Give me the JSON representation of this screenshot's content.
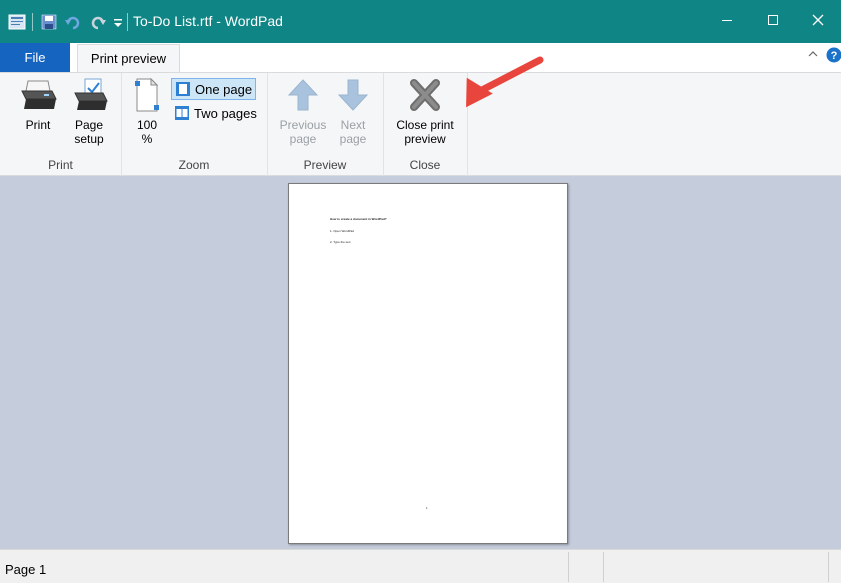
{
  "window": {
    "title": "To-Do List.rtf - WordPad",
    "minimize_icon": "minimize-icon",
    "maximize_icon": "maximize-icon",
    "close_icon": "close-icon",
    "accent_color": "#0f8585"
  },
  "quick_access": {
    "app_icon": "wordpad-icon",
    "save_icon": "save-icon",
    "undo_icon": "undo-icon",
    "redo_icon": "redo-icon",
    "customize_icon": "customize-dropdown-icon"
  },
  "tabs": {
    "file_label": "File",
    "print_preview_label": "Print preview",
    "file_color": "#1564c0"
  },
  "ribbon": {
    "print_group": {
      "label": "Print",
      "print_button": "Print",
      "page_setup_line1": "Page",
      "page_setup_line2": "setup"
    },
    "zoom_group": {
      "label": "Zoom",
      "zoom_line1": "100",
      "zoom_line2": "%",
      "one_page": "One page",
      "two_pages": "Two pages",
      "selected": "One page"
    },
    "preview_group": {
      "label": "Preview",
      "previous_line1": "Previous",
      "previous_line2": "page",
      "next_line1": "Next",
      "next_line2": "page"
    },
    "close_group": {
      "label": "Close",
      "close_line1": "Close print",
      "close_line2": "preview"
    }
  },
  "annotation": {
    "arrow_color": "#e8453c"
  },
  "document": {
    "heading": "How to create a document in WordPad?",
    "line1": "1. Open WordPad",
    "line2": "2. Type the text",
    "page_number": "1"
  },
  "status": {
    "page_text": "Page 1"
  },
  "preview_background": "#c5ccdb"
}
